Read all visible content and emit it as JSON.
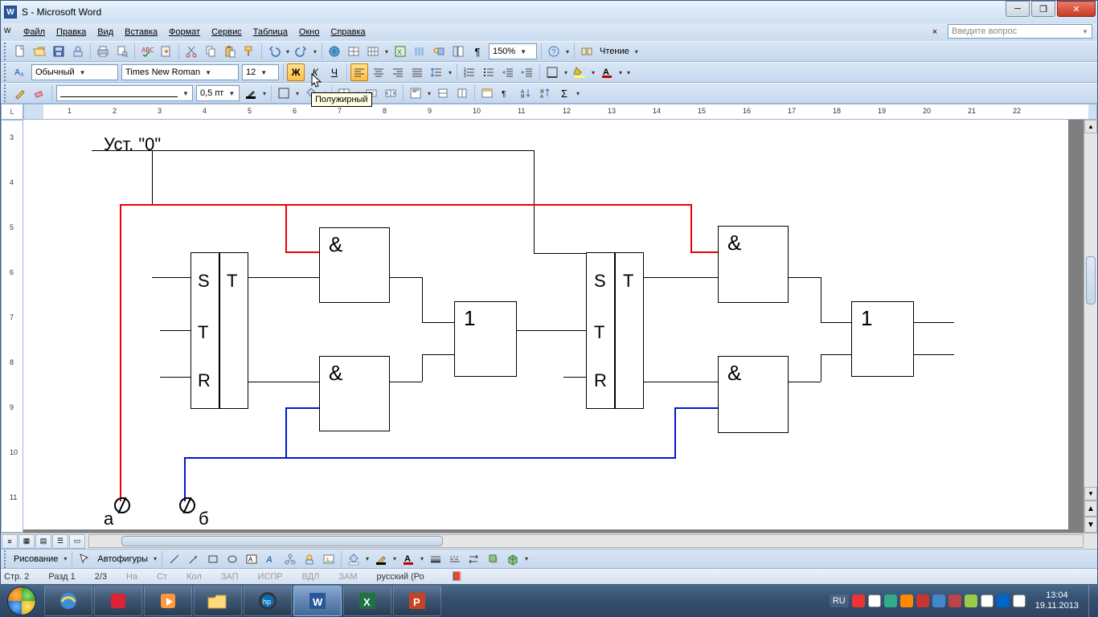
{
  "window": {
    "title": "S - Microsoft Word"
  },
  "menu": {
    "items": [
      "Файл",
      "Правка",
      "Вид",
      "Вставка",
      "Формат",
      "Сервис",
      "Таблица",
      "Окно",
      "Справка"
    ],
    "ask_placeholder": "Введите вопрос"
  },
  "standard_toolbar": {
    "zoom": "150%",
    "read_label": "Чтение"
  },
  "formatting_toolbar": {
    "style_label": "Обычный",
    "font_name": "Times New Roman",
    "font_size": "12"
  },
  "drawing_toolbar": {
    "draw_label": "Рисование",
    "autoshapes_label": "Автофигуры"
  },
  "tables_toolbar": {
    "line_weight": "0,5 пт"
  },
  "tooltip": {
    "bold": "Полужирный"
  },
  "ruler": {
    "nums": [
      "1",
      "2",
      "1",
      "2",
      "3",
      "4",
      "5",
      "6",
      "7",
      "8",
      "9",
      "10",
      "11",
      "12",
      "13",
      "14",
      "15",
      "16",
      "17",
      "18",
      "19",
      "20",
      "21",
      "22"
    ]
  },
  "vruler": {
    "nums": [
      "3",
      "4",
      "5",
      "6",
      "7",
      "8",
      "9",
      "10",
      "11"
    ]
  },
  "diagram": {
    "title": "Уст. \"0\"",
    "labels": {
      "amp1": "&",
      "amp2": "&",
      "amp3": "&",
      "amp4": "&",
      "or1": "1",
      "or2": "1",
      "s": "S",
      "t": "T",
      "tt": "T",
      "r": "R",
      "a": "а",
      "b": "б"
    }
  },
  "status": {
    "page": "Стр. 2",
    "sect": "Разд 1",
    "pages": "2/3",
    "at": "На",
    "ln": "Ст",
    "col": "Кол",
    "rec": "ЗАП",
    "trk": "ИСПР",
    "ext": "ВДЛ",
    "ovr": "ЗАМ",
    "lang": "русский (Ро"
  },
  "taskbar": {
    "lang": "RU",
    "time": "13:04",
    "date": "19.11.2013"
  }
}
